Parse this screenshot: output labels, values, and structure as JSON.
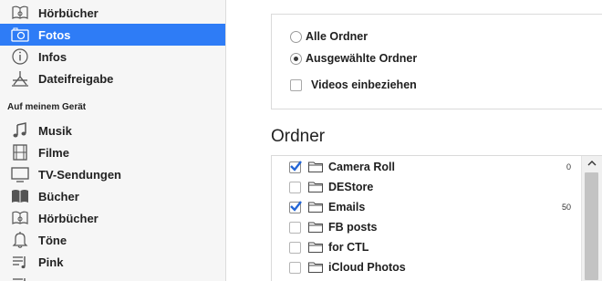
{
  "sidebar": {
    "items_top": [
      {
        "label": "Hörbücher",
        "icon": "audiobook-icon"
      },
      {
        "label": "Fotos",
        "icon": "camera-icon",
        "selected": true
      },
      {
        "label": "Infos",
        "icon": "info-icon"
      },
      {
        "label": "Dateifreigabe",
        "icon": "file-sharing-icon"
      }
    ],
    "section_header": "Auf meinem Gerät",
    "items_device": [
      {
        "label": "Musik",
        "icon": "music-note-icon"
      },
      {
        "label": "Filme",
        "icon": "film-icon"
      },
      {
        "label": "TV-Sendungen",
        "icon": "tv-icon"
      },
      {
        "label": "Bücher",
        "icon": "book-icon"
      },
      {
        "label": "Hörbücher",
        "icon": "audiobook-icon"
      },
      {
        "label": "Töne",
        "icon": "bell-icon"
      },
      {
        "label": "Pink",
        "icon": "playlist-icon"
      },
      {
        "label": "",
        "icon": "playlist-icon"
      }
    ]
  },
  "options": {
    "radio_all": "Alle Ordner",
    "radio_selected": "Ausgewählte Ordner",
    "selected_radio": "Ausgewählte Ordner",
    "include_videos": "Videos einbeziehen",
    "include_videos_checked": false
  },
  "ordner_title": "Ordner",
  "folders": [
    {
      "name": "Camera Roll",
      "checked": true,
      "count": "0"
    },
    {
      "name": "DEStore",
      "checked": false,
      "count": ""
    },
    {
      "name": "Emails",
      "checked": true,
      "count": "50"
    },
    {
      "name": "FB posts",
      "checked": false,
      "count": ""
    },
    {
      "name": "for CTL",
      "checked": false,
      "count": ""
    },
    {
      "name": "iCloud Photos",
      "checked": false,
      "count": ""
    }
  ],
  "colors": {
    "selection": "#2e7cf6",
    "check": "#2466d6"
  }
}
